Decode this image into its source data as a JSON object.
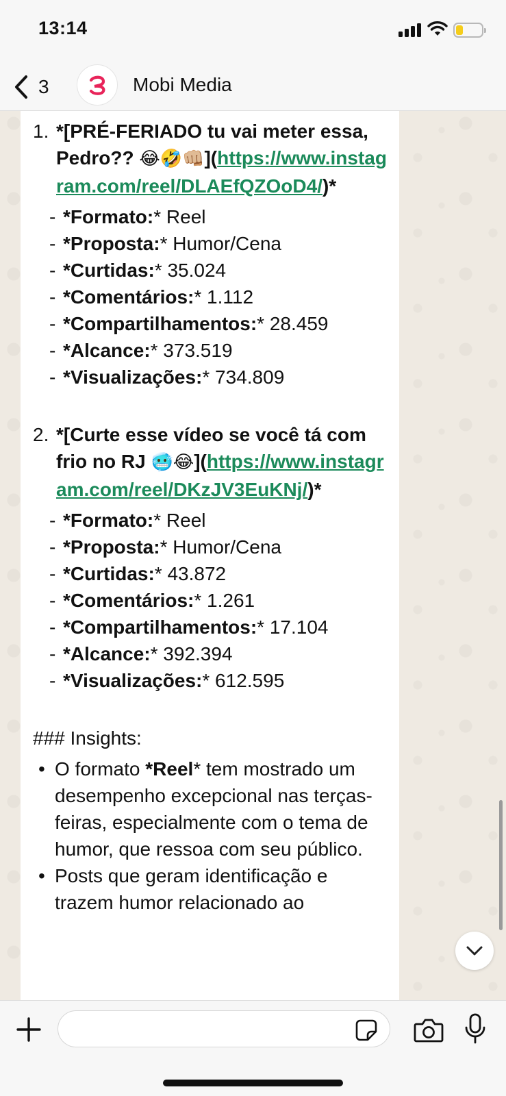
{
  "status_bar": {
    "time": "13:14",
    "battery_level": 0.2,
    "icons": [
      "signal-icon",
      "wifi-icon",
      "battery-icon"
    ]
  },
  "header": {
    "back_count": "3",
    "chat_name": "Mobi Media",
    "avatar_icon": "mobi-media-logo"
  },
  "message": {
    "posts": [
      {
        "number": "1.",
        "title_prefix": "*[PRÉ-FERIADO tu vai meter essa, Pedro?? ",
        "emojis": "😂🤣👊🏼",
        "bracket_open": "](",
        "link": "https://www.instagram.com/reel/DLAEfQZOoD4/",
        "title_suffix": ")*",
        "details": [
          {
            "label": "*Formato:",
            "value": "* Reel"
          },
          {
            "label": "*Proposta:",
            "value": "* Humor/Cena"
          },
          {
            "label": "*Curtidas:",
            "value": "* 35.024"
          },
          {
            "label": "*Comentários:",
            "value": "* 1.112"
          },
          {
            "label": "*Compartilhamentos:",
            "value": "* 28.459"
          },
          {
            "label": "*Alcance:",
            "value": "* 373.519"
          },
          {
            "label": "*Visualizações:",
            "value": "* 734.809"
          }
        ]
      },
      {
        "number": "2.",
        "title_prefix": "*[Curte esse vídeo se você tá com frio no RJ ",
        "emojis": "🥶😂",
        "bracket_open": "](",
        "link": "https://www.instagram.com/reel/DKzJV3EuKNj/",
        "title_suffix": ")*",
        "details": [
          {
            "label": "*Formato:",
            "value": "* Reel"
          },
          {
            "label": "*Proposta:",
            "value": "* Humor/Cena"
          },
          {
            "label": "*Curtidas:",
            "value": "* 43.872"
          },
          {
            "label": "*Comentários:",
            "value": "* 1.261"
          },
          {
            "label": "*Compartilhamentos:",
            "value": "* 17.104"
          },
          {
            "label": "*Alcance:",
            "value": "* 392.394"
          },
          {
            "label": "*Visualizações:",
            "value": "* 612.595"
          }
        ]
      }
    ],
    "insights_heading": "### Insights:",
    "insights": [
      {
        "pre": "O formato ",
        "bold": "*Reel",
        "post": "* tem mostrado um desempenho excepcional nas terças-feiras, especialmente com o tema de humor, que ressoa com seu público."
      },
      {
        "pre": "Posts que geram identificação e trazem humor relacionado ao",
        "bold": "",
        "post": ""
      }
    ]
  },
  "input": {
    "placeholder": ""
  },
  "colors": {
    "link": "#1b8a5a",
    "accent_logo": "#e8245a",
    "battery_fill": "#f5cd1b"
  }
}
